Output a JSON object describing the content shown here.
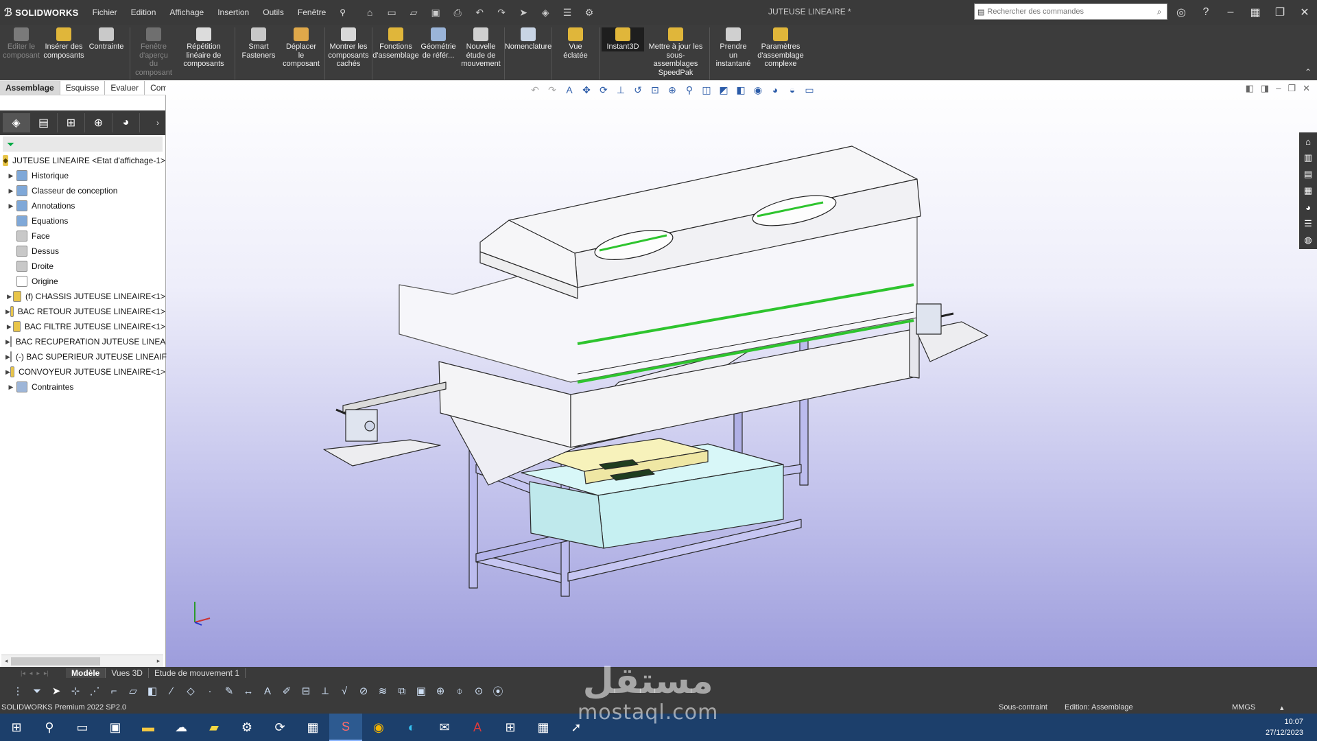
{
  "app": {
    "name": "SOLIDWORKS",
    "document_title": "JUTEUSE LINEAIRE *"
  },
  "menu": [
    "Fichier",
    "Edition",
    "Affichage",
    "Insertion",
    "Outils",
    "Fenêtre"
  ],
  "search": {
    "placeholder": "Rechercher des commandes"
  },
  "ribbon": [
    {
      "label": "Editer le composant",
      "enabled": false,
      "color": "#7a7a7a"
    },
    {
      "label": "Insérer des composants",
      "enabled": true,
      "color": "#e0b63a"
    },
    {
      "label": "Contrainte",
      "enabled": true,
      "color": "#c9c9c9"
    },
    {
      "label": "Fenêtre d'aperçu du composant",
      "enabled": false,
      "color": "#6f6f6f"
    },
    {
      "label": "Répétition linéaire de composants",
      "enabled": true,
      "color": "#dcdcdc"
    },
    {
      "label": "Smart Fasteners",
      "enabled": true,
      "color": "#c8c8c8"
    },
    {
      "label": "Déplacer le composant",
      "enabled": true,
      "color": "#dfa84a"
    },
    {
      "label": "Montrer les composants cachés",
      "enabled": true,
      "color": "#d8d8d8"
    },
    {
      "label": "Fonctions d'assemblage",
      "enabled": true,
      "color": "#e0b63a"
    },
    {
      "label": "Géométrie de référ...",
      "enabled": true,
      "color": "#9ab4d8"
    },
    {
      "label": "Nouvelle étude de mouvement",
      "enabled": true,
      "color": "#d0d0d0"
    },
    {
      "label": "Nomenclature",
      "enabled": true,
      "color": "#c8d4e4"
    },
    {
      "label": "Vue éclatée",
      "enabled": true,
      "color": "#e0b63a"
    },
    {
      "label": "Instant3D",
      "enabled": true,
      "active": true,
      "color": "#e0b63a"
    },
    {
      "label": "Mettre à jour les sous-assemblages SpeedPak",
      "enabled": true,
      "color": "#e0b63a"
    },
    {
      "label": "Prendre un instantané",
      "enabled": true,
      "color": "#d0d0d0"
    },
    {
      "label": "Paramètres d'assemblage complexe",
      "enabled": true,
      "color": "#e0b63a"
    }
  ],
  "command_tabs": [
    "Assemblage",
    "Esquisse",
    "Evaluer",
    "Compléments de SOLIDWORKS"
  ],
  "tree": {
    "root": "JUTEUSE LINEAIRE <Etat d'affichage-1>",
    "items": [
      {
        "label": "Historique",
        "expandable": true,
        "icon": "history-icon"
      },
      {
        "label": "Classeur de conception",
        "expandable": true,
        "icon": "folder-icon"
      },
      {
        "label": "Annotations",
        "expandable": true,
        "icon": "annotation-icon"
      },
      {
        "label": "Equations",
        "expandable": false,
        "icon": "equation-icon"
      },
      {
        "label": "Face",
        "expandable": false,
        "icon": "plane-icon"
      },
      {
        "label": "Dessus",
        "expandable": false,
        "icon": "plane-icon"
      },
      {
        "label": "Droite",
        "expandable": false,
        "icon": "plane-icon"
      },
      {
        "label": "Origine",
        "expandable": false,
        "icon": "origin-icon"
      },
      {
        "label": "(f) CHASSIS JUTEUSE LINEAIRE<1>",
        "expandable": true,
        "icon": "assembly-icon"
      },
      {
        "label": "BAC RETOUR JUTEUSE LINEAIRE<1>",
        "expandable": true,
        "icon": "assembly-icon"
      },
      {
        "label": "BAC FILTRE JUTEUSE LINEAIRE<1>",
        "expandable": true,
        "icon": "assembly-icon"
      },
      {
        "label": "BAC RECUPERATION JUTEUSE LINEA",
        "expandable": true,
        "icon": "assembly-icon"
      },
      {
        "label": "(-) BAC SUPERIEUR JUTEUSE LINEAIF",
        "expandable": true,
        "icon": "assembly-icon"
      },
      {
        "label": "CONVOYEUR JUTEUSE LINEAIRE<1>",
        "expandable": true,
        "icon": "assembly-icon"
      },
      {
        "label": "Contraintes",
        "expandable": true,
        "icon": "mates-icon"
      }
    ]
  },
  "bottom_tabs": [
    "Modèle",
    "Vues 3D",
    "Etude de mouvement 1"
  ],
  "status": {
    "product": "SOLIDWORKS Premium 2022 SP2.0",
    "constraint": "Sous-contraint",
    "edition": "Edition: Assemblage",
    "units": "MMGS"
  },
  "clock": {
    "time": "10:07",
    "date": "27/12/2023"
  },
  "watermark": {
    "arabic": "مستقل",
    "latin": "mostaql.com"
  },
  "colors": {
    "frame": "#b9b9ec",
    "tray_yellow": "#f5f0b5",
    "tank_cyan": "#cdf4f5",
    "gasket_green": "#2ec42e",
    "body": "#f3f3f5"
  }
}
